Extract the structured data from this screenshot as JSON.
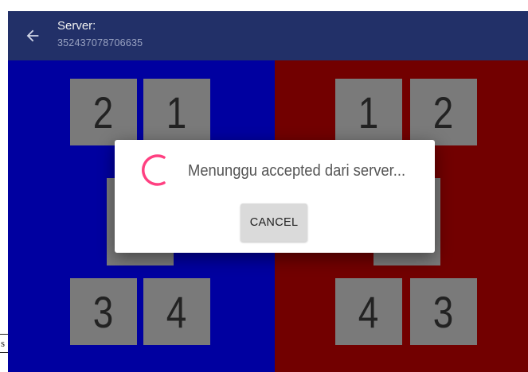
{
  "header": {
    "title": "Server:",
    "subtitle": "352437078706635",
    "background_color": "#223068"
  },
  "fields": {
    "left": {
      "color": "#0000a0",
      "tiles_top": [
        "2",
        "1"
      ],
      "tiles_bottom": [
        "3",
        "4"
      ]
    },
    "right": {
      "color": "#720000",
      "tiles_top": [
        "1",
        "2"
      ],
      "tiles_bottom": [
        "4",
        "3"
      ]
    },
    "tile_color": "#7a7a7a"
  },
  "dialog": {
    "message": "Menunggu accepted dari server...",
    "cancel_label": "CANCEL",
    "spinner_color": "#ff4081"
  },
  "clipped_label": "s"
}
